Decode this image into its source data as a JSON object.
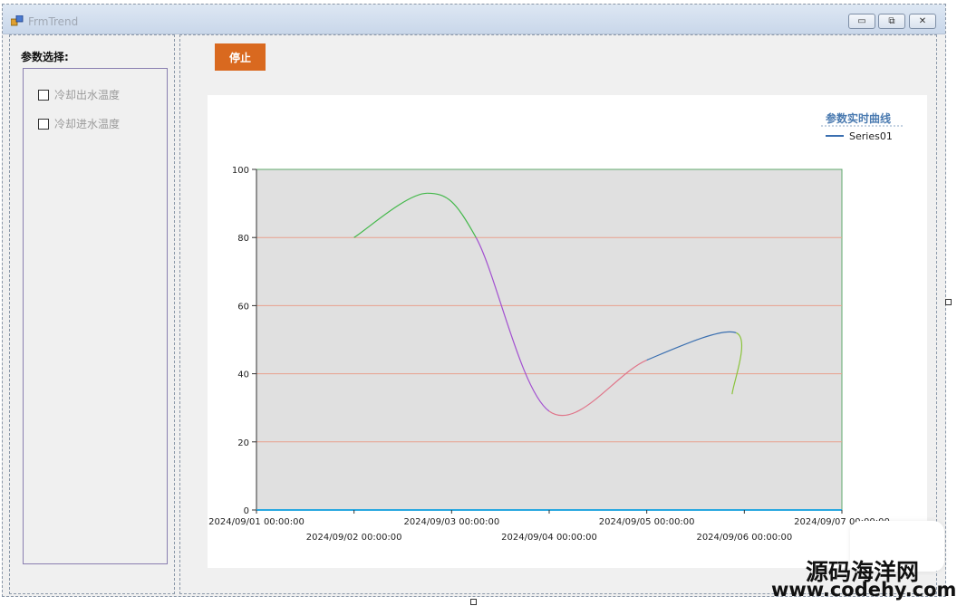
{
  "window": {
    "title": "FrmTrend",
    "minimize_glyph": "▭",
    "maximize_glyph": "⧉",
    "close_glyph": "✕"
  },
  "params": {
    "label": "参数选择:",
    "options": [
      {
        "label": "冷却出水温度",
        "checked": false
      },
      {
        "label": "冷却进水温度",
        "checked": false
      }
    ]
  },
  "toolbar": {
    "stop_label": "停止"
  },
  "watermark": {
    "cn": "源码海洋网",
    "url": "www.codehy.com"
  },
  "chart_data": {
    "type": "line",
    "title": "参数实时曲线",
    "legend": [
      "Series01"
    ],
    "legend_position": "top-right",
    "ylim": [
      0,
      100
    ],
    "yticks": [
      0,
      20,
      40,
      60,
      80,
      100
    ],
    "x_range": [
      "2024/09/01 00:00:00",
      "2024/09/07 00:00:00"
    ],
    "xticks": [
      "2024/09/01 00:00:00",
      "2024/09/02 00:00:00",
      "2024/09/03 00:00:00",
      "2024/09/04 00:00:00",
      "2024/09/05 00:00:00",
      "2024/09/06 00:00:00",
      "2024/09/07 00:00:00"
    ],
    "grid": "horizontal",
    "colors": {
      "grid": "#e8a08e",
      "plot_bg": "#e0e0e0",
      "plot_border": "#5fa86d",
      "baseline": "#29a8e0",
      "legend_line": "#3a6fb0",
      "title": "#4a7ab0"
    },
    "series": [
      {
        "name": "Series01",
        "points": [
          {
            "x": "2024/09/02 00:00:00",
            "y": 80,
            "color": "#43b84a"
          },
          {
            "x": "2024/09/02 18:00:00",
            "y": 93,
            "color": "#43b84a"
          },
          {
            "x": "2024/09/03 06:00:00",
            "y": 80,
            "color": "#a24fd0"
          },
          {
            "x": "2024/09/04 00:00:00",
            "y": 29,
            "color": "#e0768a"
          },
          {
            "x": "2024/09/05 00:00:00",
            "y": 44,
            "color": "#3a6fb0"
          },
          {
            "x": "2024/09/05 22:00:00",
            "y": 52,
            "color": "#8ac33b"
          },
          {
            "x": "2024/09/05 21:00:00",
            "y": 34,
            "color": "#8ac33b"
          }
        ]
      }
    ]
  }
}
